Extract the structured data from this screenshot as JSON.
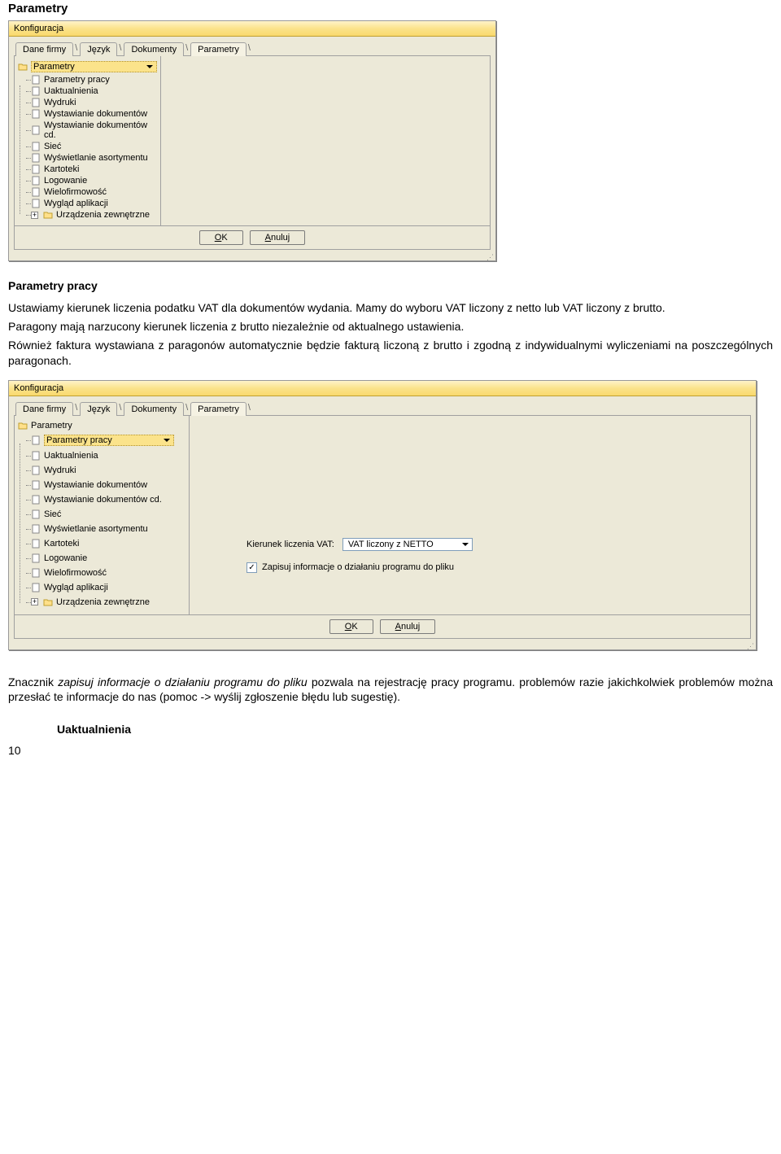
{
  "doc": {
    "heading_parametry": "Parametry",
    "heading_parametry_pracy": "Parametry pracy",
    "para1": "Ustawiamy kierunek liczenia podatku VAT dla dokumentów wydania. Mamy do wyboru VAT liczony z netto lub VAT liczony z brutto.",
    "para2": "Paragony mają narzucony kierunek liczenia z brutto niezależnie od aktualnego ustawienia.",
    "para3": "Również faktura wystawiana z paragonów automatycznie będzie fakturą liczoną z brutto i zgodną z indywidualnymi wyliczeniami na poszczególnych paragonach.",
    "para4a": "Znacznik ",
    "para4b_italic": "zapisuj informacje o działaniu programu do pliku",
    "para4c": " pozwala na rejestrację pracy programu. problemów razie jakichkolwiek problemów można przesłać te informacje do nas (pomoc -> wyślij zgłoszenie błędu lub sugestię).",
    "heading_uaktualnienia": "Uaktualnienia",
    "page_num": "10"
  },
  "win": {
    "title": "Konfiguracja",
    "tabs": [
      "Dane firmy",
      "Język",
      "Dokumenty",
      "Parametry"
    ],
    "tree": {
      "root": "Parametry",
      "items": [
        "Parametry pracy",
        "Uaktualnienia",
        "Wydruki",
        "Wystawianie dokumentów",
        "Wystawianie dokumentów cd.",
        "Sieć",
        "Wyświetlanie asortymentu",
        "Kartoteki",
        "Logowanie",
        "Wielofirmowość",
        "Wygląd aplikacji"
      ],
      "last_item": "Urządzenia zewnętrzne"
    },
    "buttons": {
      "ok": "OK",
      "cancel": "Anuluj"
    }
  },
  "form": {
    "vat_label": "Kierunek liczenia  VAT:",
    "vat_value": "VAT liczony z NETTO",
    "chk_label": "Zapisuj informacje o działaniu programu do pliku"
  }
}
